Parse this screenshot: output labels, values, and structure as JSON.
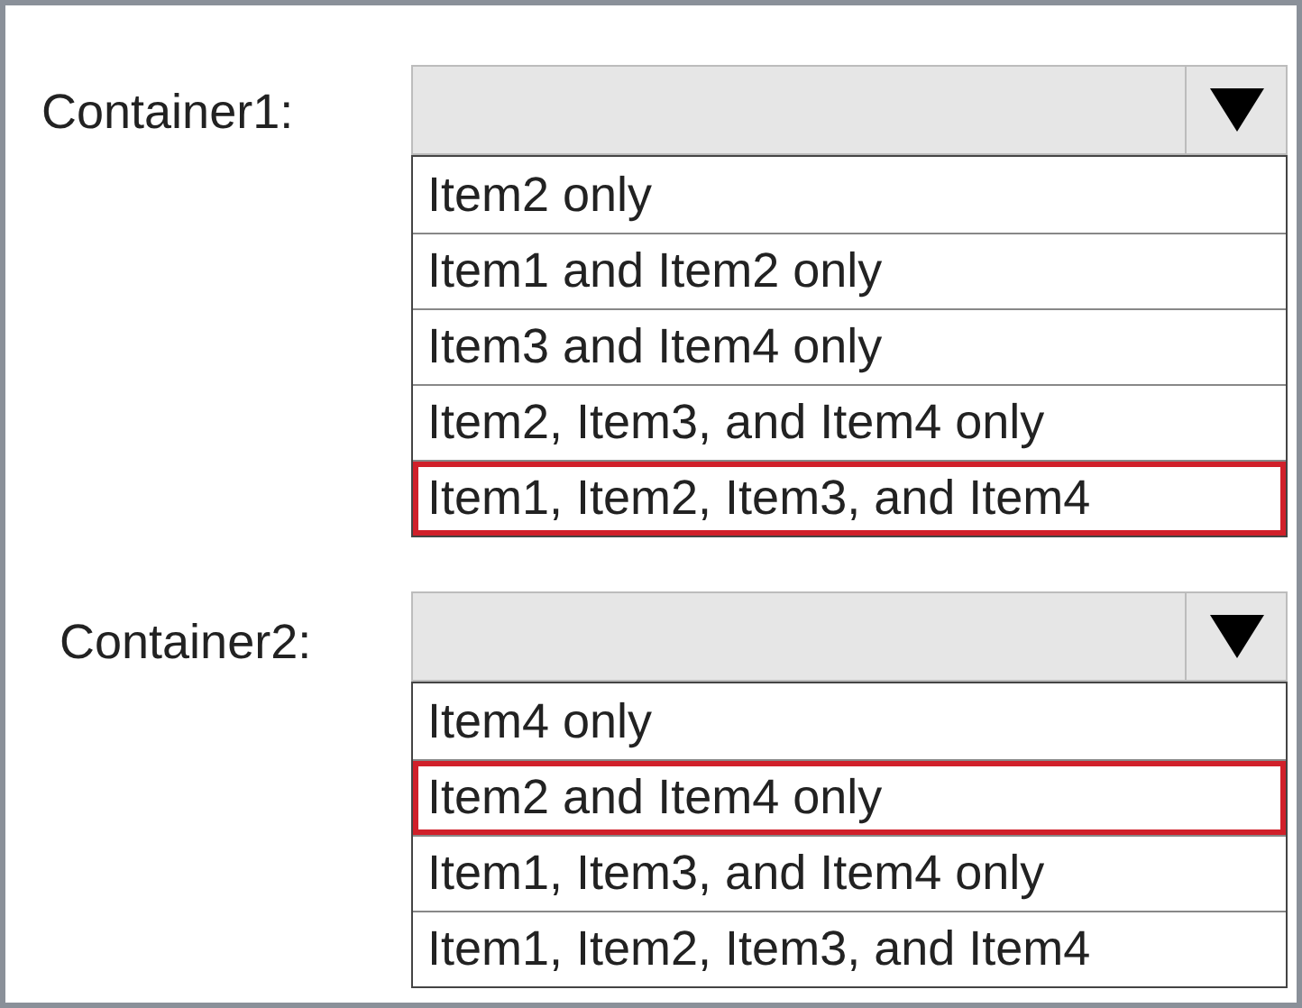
{
  "dropdowns": [
    {
      "label": "Container1:",
      "options": [
        {
          "text": "Item2 only",
          "selected": false
        },
        {
          "text": "Item1 and Item2 only",
          "selected": false
        },
        {
          "text": "Item3 and Item4 only",
          "selected": false
        },
        {
          "text": "Item2, Item3, and Item4 only",
          "selected": false
        },
        {
          "text": "Item1, Item2, Item3, and Item4",
          "selected": true
        }
      ]
    },
    {
      "label": "Container2:",
      "options": [
        {
          "text": "Item4 only",
          "selected": false
        },
        {
          "text": "Item2 and Item4 only",
          "selected": true
        },
        {
          "text": "Item1, Item3, and Item4 only",
          "selected": false
        },
        {
          "text": "Item1, Item2, Item3, and Item4",
          "selected": false
        }
      ]
    }
  ]
}
